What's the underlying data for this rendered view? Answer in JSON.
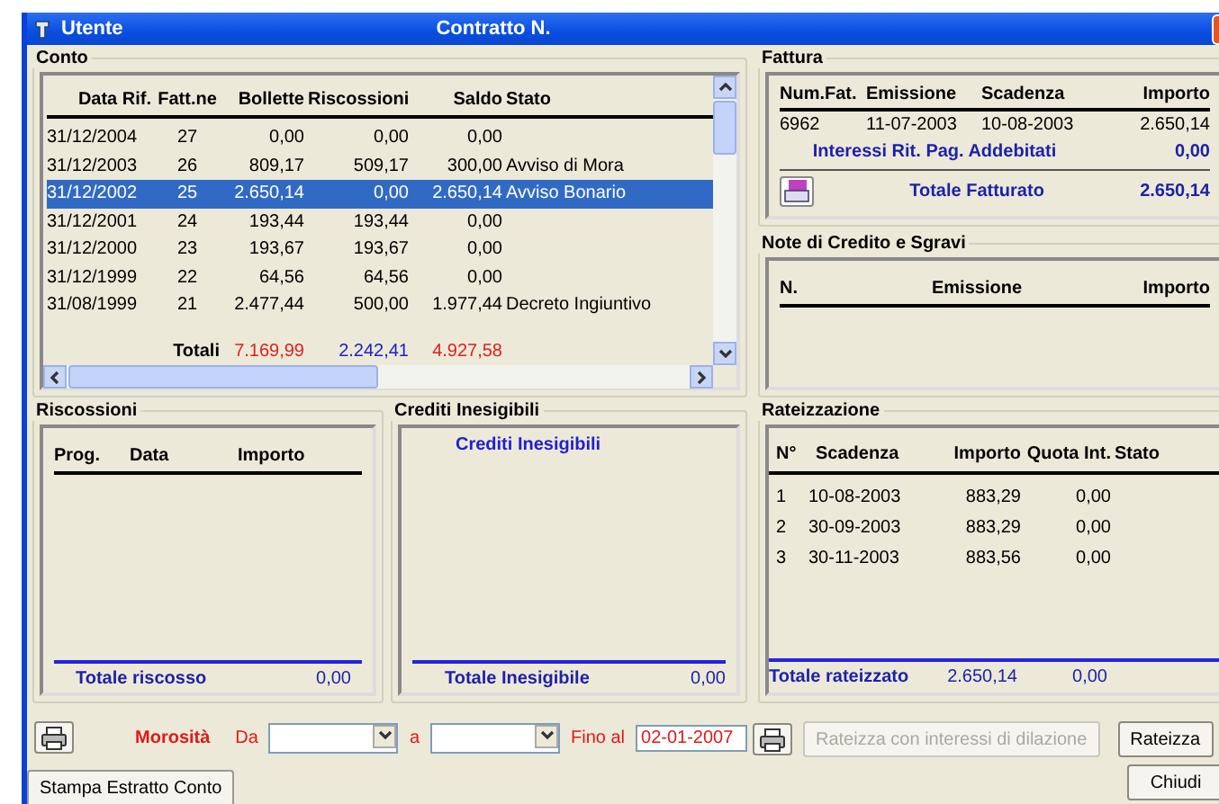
{
  "window": {
    "title": "Utente",
    "subtitle": "Contratto N."
  },
  "conto": {
    "legend": "Conto",
    "columns": [
      "Data Rif.",
      "Fatt.ne",
      "Bollette",
      "Riscossioni",
      "Saldo",
      "Stato"
    ],
    "rows": [
      {
        "cells": [
          "31/12/2004",
          "27",
          "0,00",
          "0,00",
          "0,00",
          ""
        ],
        "selected": false
      },
      {
        "cells": [
          "31/12/2003",
          "26",
          "809,17",
          "509,17",
          "300,00",
          "Avviso di Mora"
        ],
        "selected": false
      },
      {
        "cells": [
          "31/12/2002",
          "25",
          "2.650,14",
          "0,00",
          "2.650,14",
          "Avviso Bonario"
        ],
        "selected": true
      },
      {
        "cells": [
          "31/12/2001",
          "24",
          "193,44",
          "193,44",
          "0,00",
          ""
        ],
        "selected": false
      },
      {
        "cells": [
          "31/12/2000",
          "23",
          "193,67",
          "193,67",
          "0,00",
          ""
        ],
        "selected": false
      },
      {
        "cells": [
          "31/12/1999",
          "22",
          "64,56",
          "64,56",
          "0,00",
          ""
        ],
        "selected": false
      },
      {
        "cells": [
          "31/08/1999",
          "21",
          "2.477,44",
          "500,00",
          "1.977,44",
          "Decreto Ingiuntivo"
        ],
        "selected": false
      }
    ],
    "totals_label": "Totali",
    "totals": [
      {
        "value": "7.169,99",
        "color": "#e02020"
      },
      {
        "value": "2.242,41",
        "color": "#2020c0"
      },
      {
        "value": "4.927,58",
        "color": "#e02020"
      }
    ]
  },
  "fattura": {
    "legend": "Fattura",
    "columns": [
      "Num.Fat.",
      "Emissione",
      "Scadenza",
      "Importo"
    ],
    "rows": [
      [
        "6962",
        "11-07-2003",
        "10-08-2003",
        "2.650,14"
      ]
    ],
    "interessi": {
      "label": "Interessi Rit. Pag. Addebitati",
      "value": "0,00"
    },
    "totale": {
      "label": "Totale Fatturato",
      "value": "2.650,14"
    }
  },
  "note_credito": {
    "legend": "Note di Credito e Sgravi",
    "columns": [
      "N.",
      "Emissione",
      "Importo"
    ]
  },
  "riscossioni": {
    "legend": "Riscossioni",
    "columns": [
      "Prog.",
      "Data",
      "Importo"
    ],
    "total_label": "Totale riscosso",
    "total_value": "0,00"
  },
  "crediti": {
    "legend": "Crediti Inesigibili",
    "heading": "Crediti Inesigibili",
    "total_label": "Totale Inesigibile",
    "total_value": "0,00"
  },
  "rateizzazione": {
    "legend": "Rateizzazione",
    "columns": [
      "N°",
      "Scadenza",
      "Importo",
      "Quota Int.",
      "Stato"
    ],
    "rows": [
      [
        "1",
        "10-08-2003",
        "883,29",
        "0,00",
        ""
      ],
      [
        "2",
        "30-09-2003",
        "883,29",
        "0,00",
        ""
      ],
      [
        "3",
        "30-11-2003",
        "883,56",
        "0,00",
        ""
      ]
    ],
    "total_label": "Totale rateizzato",
    "total_values": [
      "2.650,14",
      "0,00"
    ]
  },
  "morosita": {
    "label": "Morosità",
    "da_label": "Da",
    "a_label": "a",
    "fino_label": "Fino al",
    "fino_value": "02-01-2007"
  },
  "buttons": {
    "rateizza_interessi": {
      "label": "Rateizza con interessi di dilazione",
      "disabled": true
    },
    "rateizza": {
      "label": "Rateizza",
      "disabled": false
    },
    "stampa": {
      "label": "Stampa Estratto Conto"
    },
    "chiudi": {
      "label": "Chiudi"
    }
  }
}
